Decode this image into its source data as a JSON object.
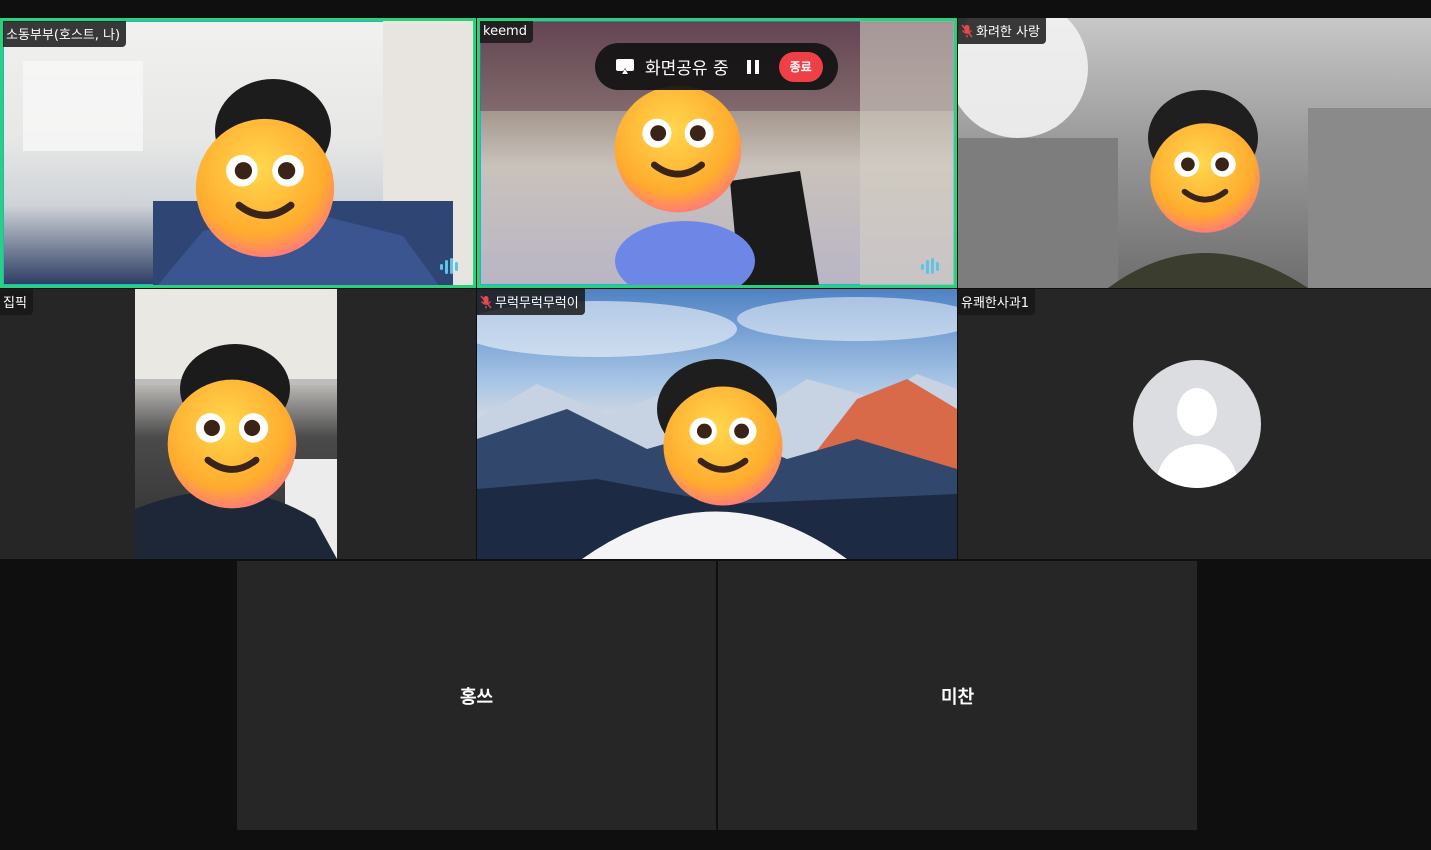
{
  "share_bar": {
    "status": "화면공유 중",
    "stop_label": "종료"
  },
  "participants": [
    {
      "name": "소동부부(호스트, 나)"
    },
    {
      "name": "keemd"
    },
    {
      "name": "화려한 사랑"
    },
    {
      "name": "집픽"
    },
    {
      "name": "무럭무럭무럭이"
    },
    {
      "name": "유쾌한사과1"
    },
    {
      "name": "홍쓰"
    },
    {
      "name": "미찬"
    }
  ],
  "colors": {
    "speaking_border": "#2bd07a",
    "stop_button": "#ef3f47",
    "mute": "#e5484d"
  }
}
